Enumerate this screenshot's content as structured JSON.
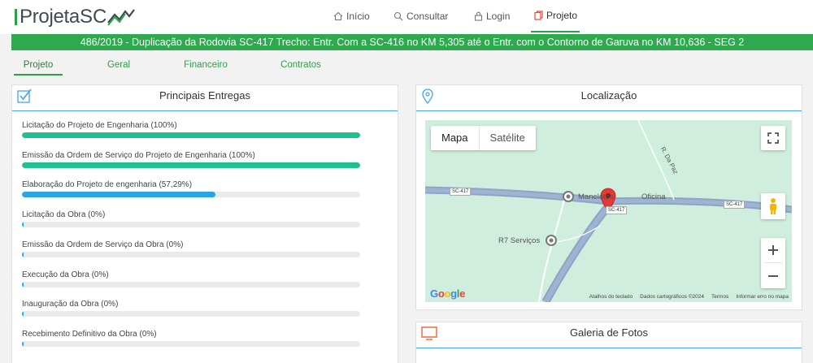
{
  "logo": {
    "text_part1": "Projeta",
    "text_part2": "SC"
  },
  "nav": {
    "inicio": "Início",
    "consultar": "Consultar",
    "login": "Login",
    "projeto": "Projeto"
  },
  "banner": {
    "title": "486/2019 - Duplicação da Rodovia SC-417 Trecho: Entr. Com a SC-416 no KM 5,305 até o Entr. com o Contorno de Garuva no KM 10,636 - SEG 2"
  },
  "tabs": [
    "Projeto",
    "Geral",
    "Financeiro",
    "Contratos"
  ],
  "entregas": {
    "title": "Principais Entregas",
    "items": [
      {
        "label": "Licitação do Projeto de Engenharia (100%)",
        "progress": 100,
        "color": "#1fbf8f"
      },
      {
        "label": "Emissão da Ordem de Serviço do Projeto de Engenharia (100%)",
        "progress": 100,
        "color": "#1fbf8f"
      },
      {
        "label": "Elaboração do Projeto de engenharia (57,29%)",
        "progress": 57.29,
        "color": "#2aa5e3"
      },
      {
        "label": "Licitação da Obra (0%)",
        "progress": 0,
        "color": "#2aa5e3"
      },
      {
        "label": "Emissão da Ordem de Serviço da Obra (0%)",
        "progress": 0,
        "color": "#2aa5e3"
      },
      {
        "label": "Execução da Obra (0%)",
        "progress": 0,
        "color": "#2aa5e3"
      },
      {
        "label": "Inauguração da Obra (0%)",
        "progress": 0,
        "color": "#2aa5e3"
      },
      {
        "label": "Recebimento Definitivo da Obra (0%)",
        "progress": 0,
        "color": "#2aa5e3"
      }
    ]
  },
  "localizacao": {
    "title": "Localização",
    "map_type_map": "Mapa",
    "map_type_sat": "Satélite",
    "places": {
      "p1": "Manelotos",
      "p2": "Oficina",
      "p3": "R7 Serviços",
      "street": "R. Da Paz"
    },
    "roads": {
      "r1": "SC-417",
      "r2": "SC-417",
      "r3": "SC-417"
    },
    "google": "Google",
    "footer": [
      "Atalhos do teclado",
      "Dados cartográficos ©2024",
      "Termos",
      "Informar erro no mapa"
    ]
  },
  "galeria": {
    "title": "Galeria de Fotos"
  },
  "colors": {
    "brand_green": "#2fa84f",
    "accent_blue": "#45a4e0"
  }
}
